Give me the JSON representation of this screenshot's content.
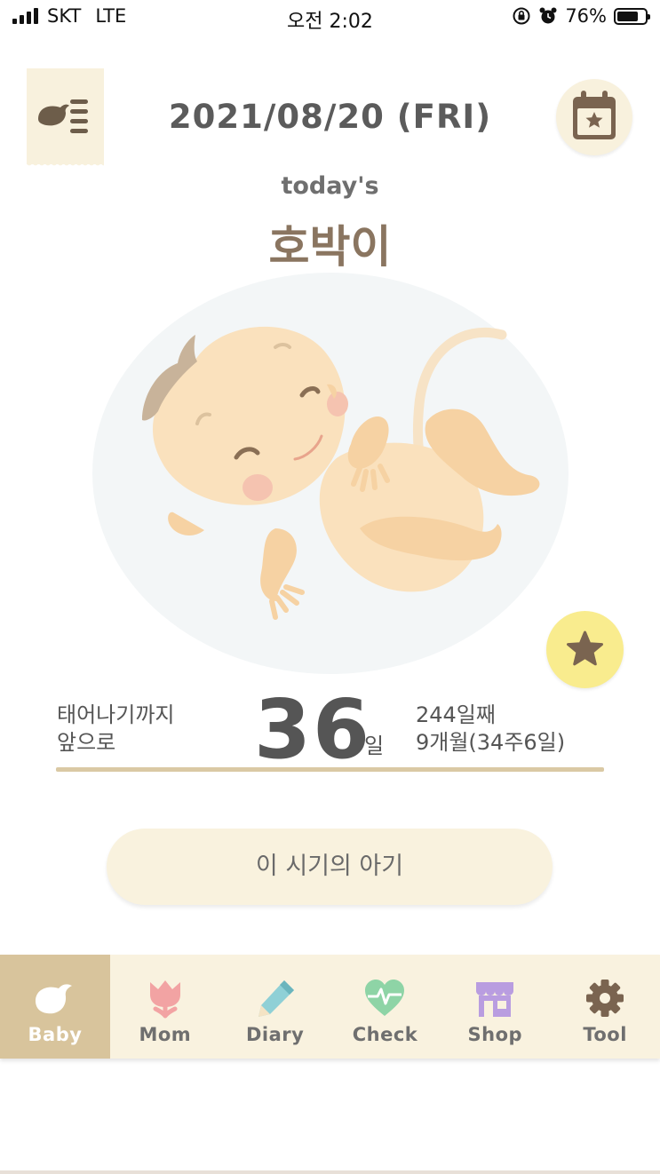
{
  "status_bar": {
    "carrier": "SKT",
    "network": "LTE",
    "time": "오전 2:02",
    "battery": "76%",
    "battery_level": 0.76
  },
  "header": {
    "date": "2021/08/20 (FRI)",
    "menu_icon": "bird-list-menu-icon",
    "calendar_icon": "calendar-star-icon"
  },
  "today": {
    "label": "today's",
    "baby_name": "호박이"
  },
  "favorite_icon": "star-icon",
  "countdown": {
    "label_line1": "태어나기까지",
    "label_line2": "앞으로",
    "days": "36",
    "unit": "일",
    "day_count": "244일째",
    "month_week": "9개월(34주6일)"
  },
  "period_button": "이 시기의 아기",
  "nav": {
    "items": [
      {
        "label": "Baby",
        "icon": "bird-icon",
        "active": true
      },
      {
        "label": "Mom",
        "icon": "tulip-icon",
        "active": false
      },
      {
        "label": "Diary",
        "icon": "pencil-icon",
        "active": false
      },
      {
        "label": "Check",
        "icon": "heartbeat-icon",
        "active": false
      },
      {
        "label": "Shop",
        "icon": "store-icon",
        "active": false
      },
      {
        "label": "Tool",
        "icon": "gear-icon",
        "active": false
      }
    ]
  },
  "colors": {
    "accent": "#d8c49c",
    "cream": "#f9f2df",
    "name": "#8a7560",
    "star_button": "#f9ec8e"
  }
}
